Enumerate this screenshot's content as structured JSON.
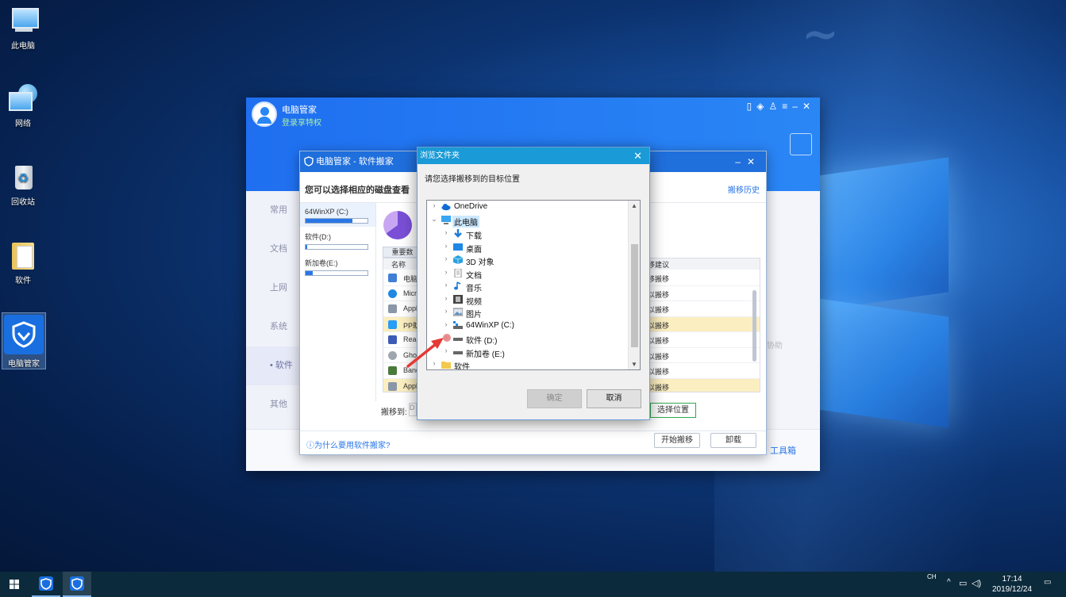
{
  "desktop": {
    "icons": [
      {
        "label": "此电脑",
        "icon": "this-pc-icon"
      },
      {
        "label": "网络",
        "icon": "network-icon"
      },
      {
        "label": "回收站",
        "icon": "recycle-bin-icon"
      },
      {
        "label": "软件",
        "icon": "folder-icon"
      },
      {
        "label": "电脑管家",
        "icon": "pc-manager-shield-icon"
      }
    ]
  },
  "app": {
    "title": "电脑管家",
    "subtitle": "登录享特权",
    "nav": [
      "常用",
      "文档",
      "上网",
      "系统",
      "软件",
      "其他"
    ],
    "active_nav": "软件",
    "toolbox_label": "工具箱",
    "help_fragment": "协助"
  },
  "mover": {
    "title": "电脑管家 - 软件搬家",
    "hint": "您可以选择相应的磁盘查看",
    "history_link": "搬移历史",
    "disks": [
      {
        "label": "64WinXP (C:)",
        "used": 0.75
      },
      {
        "label": "软件(D:)",
        "used": 0.02
      },
      {
        "label": "新加卷(E:)",
        "used": 0.12
      }
    ],
    "tab_label": "重要数",
    "columns": {
      "name": "名称",
      "suggestion": "移建议"
    },
    "rows": [
      {
        "name": "电脑",
        "suggestion": "移搬移",
        "highlight": false
      },
      {
        "name": "Micro",
        "suggestion": "以搬移",
        "highlight": false
      },
      {
        "name": "Appl",
        "suggestion": "以搬移",
        "highlight": false
      },
      {
        "name": "PP助",
        "suggestion": "以搬移",
        "highlight": true
      },
      {
        "name": "Real",
        "suggestion": "以搬移",
        "highlight": false
      },
      {
        "name": "Gho",
        "suggestion": "以搬移",
        "highlight": false
      },
      {
        "name": "Band",
        "suggestion": "以搬移",
        "highlight": false
      },
      {
        "name": "Appl",
        "suggestion": "以搬移",
        "highlight": true
      }
    ],
    "move_to_label": "搬移到:",
    "move_to_value": "D",
    "choose_location": "选择位置",
    "why_link": "为什么要用软件搬家?",
    "start_button": "开始搬移",
    "uninstall_button": "卸载"
  },
  "browse": {
    "title": "浏览文件夹",
    "hint": "请您选择搬移到的目标位置",
    "tree": [
      {
        "label": "OneDrive",
        "level": 0,
        "expanded": false,
        "icon": "onedrive-cloud-icon"
      },
      {
        "label": "此电脑",
        "level": 0,
        "expanded": true,
        "icon": "this-pc-icon",
        "selected": true
      },
      {
        "label": "下载",
        "level": 1,
        "icon": "download-icon"
      },
      {
        "label": "桌面",
        "level": 1,
        "icon": "desktop-icon"
      },
      {
        "label": "3D 对象",
        "level": 1,
        "icon": "3d-objects-icon"
      },
      {
        "label": "文档",
        "level": 1,
        "icon": "document-icon"
      },
      {
        "label": "音乐",
        "level": 1,
        "icon": "music-icon"
      },
      {
        "label": "视频",
        "level": 1,
        "icon": "video-icon"
      },
      {
        "label": "图片",
        "level": 1,
        "icon": "picture-icon"
      },
      {
        "label": "64WinXP  (C:)",
        "level": 1,
        "icon": "system-drive-icon"
      },
      {
        "label": "软件 (D:)",
        "level": 1,
        "icon": "drive-icon"
      },
      {
        "label": "新加卷 (E:)",
        "level": 1,
        "icon": "drive-icon"
      },
      {
        "label": "软件",
        "level": 0,
        "icon": "folder-icon"
      }
    ],
    "ok_button": "确定",
    "cancel_button": "取消"
  },
  "taskbar": {
    "lang": "CH",
    "time": "17:14",
    "date": "2019/12/24"
  },
  "colors": {
    "accent": "#1f6fdc",
    "dialog_title": "#1a9ad6",
    "highlight_row": "#fbeec0"
  }
}
